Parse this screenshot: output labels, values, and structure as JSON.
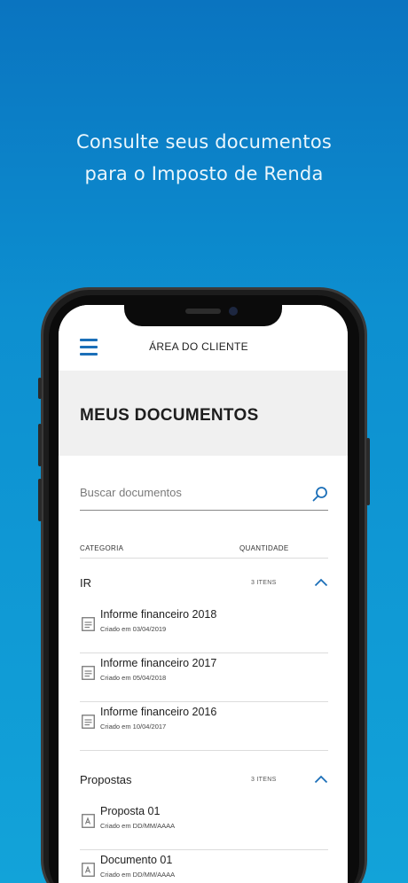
{
  "promo": {
    "line1": "Consulte seus documentos",
    "line2": "para o Imposto de Renda"
  },
  "colors": {
    "accent": "#1b6fb8",
    "background_top": "#0a74c0",
    "background_bottom": "#12a3d9",
    "header_band": "#f0f0f0"
  },
  "appbar": {
    "menu_icon": "hamburger-icon",
    "title": "ÁREA DO CLIENTE"
  },
  "page": {
    "title": "MEUS DOCUMENTOS"
  },
  "search": {
    "placeholder": "Buscar documentos",
    "value": "",
    "icon": "search-icon"
  },
  "columns": {
    "category": "CATEGORIA",
    "quantity": "QUANTIDADE"
  },
  "groups": [
    {
      "name": "IR",
      "count": "3 ITENS",
      "expanded": true,
      "documents": [
        {
          "title": "Informe financeiro 2018",
          "date": "Criado em 03/04/2019",
          "icon": "document-icon"
        },
        {
          "title": "Informe financeiro 2017",
          "date": "Criado em 05/04/2018",
          "icon": "document-icon"
        },
        {
          "title": "Informe financeiro 2016",
          "date": "Criado em 10/04/2017",
          "icon": "document-icon"
        }
      ]
    },
    {
      "name": "Propostas",
      "count": "3 ITENS",
      "expanded": true,
      "documents": [
        {
          "title": "Proposta 01",
          "date": "Criado em DD/MM/AAAA",
          "icon": "pdf-document-icon"
        },
        {
          "title": "Documento 01",
          "date": "Criado em DD/MM/AAAA",
          "icon": "pdf-document-icon"
        }
      ]
    }
  ]
}
